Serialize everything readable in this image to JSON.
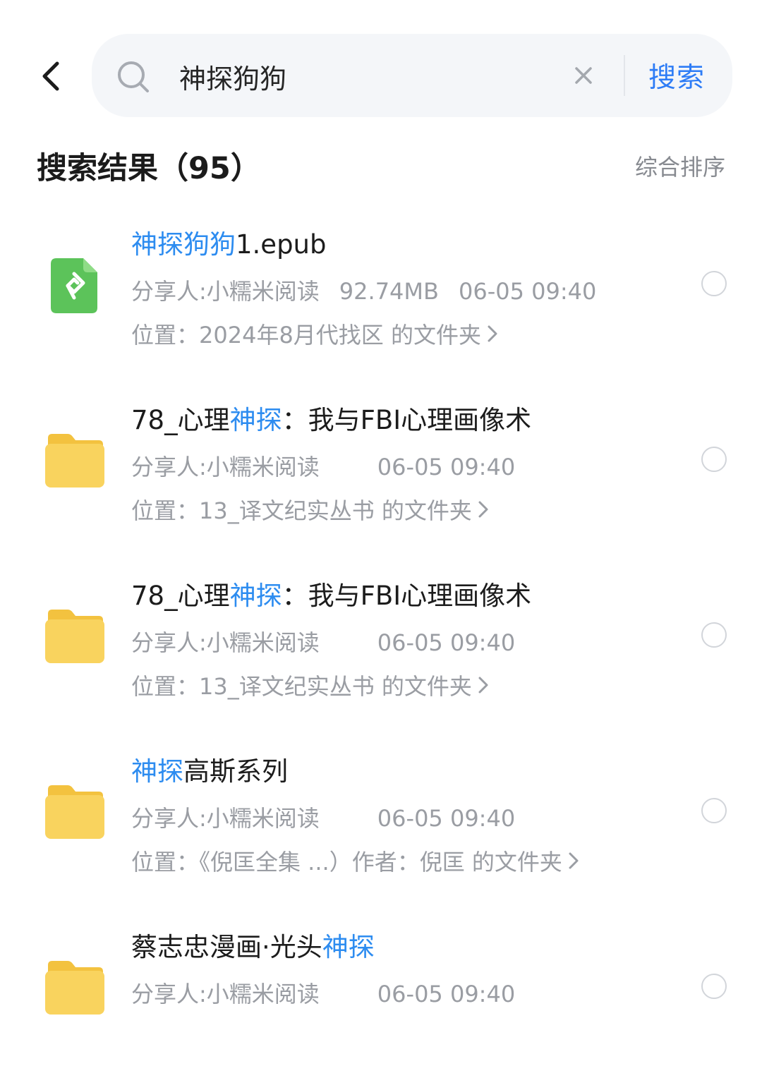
{
  "search": {
    "query": "神探狗狗",
    "search_label": "搜索"
  },
  "results": {
    "title": "搜索结果（95）",
    "sort_label": "综合排序",
    "items": [
      {
        "type": "epub",
        "title_highlight": "神探狗狗",
        "title_rest": "1.epub",
        "sharer": "分享人:小糯米阅读",
        "size": "92.74MB",
        "time": "06-05 09:40",
        "location": "位置：2024年8月代找区 的文件夹"
      },
      {
        "type": "folder",
        "title_prefix": "78_心理",
        "title_highlight": "神探",
        "title_rest": "：我与FBI心理画像术",
        "sharer": "分享人:小糯米阅读",
        "size": "",
        "time": "06-05 09:40",
        "location": "位置：13_译文纪实丛书 的文件夹"
      },
      {
        "type": "folder",
        "title_prefix": "78_心理",
        "title_highlight": "神探",
        "title_rest": "：我与FBI心理画像术",
        "sharer": "分享人:小糯米阅读",
        "size": "",
        "time": "06-05 09:40",
        "location": "位置：13_译文纪实丛书 的文件夹"
      },
      {
        "type": "folder",
        "title_prefix": "",
        "title_highlight": "神探",
        "title_rest": "高斯系列",
        "sharer": "分享人:小糯米阅读",
        "size": "",
        "time": "06-05 09:40",
        "location": "位置：《倪匡全集 ...）作者：倪匡 的文件夹"
      },
      {
        "type": "folder",
        "title_prefix": "蔡志忠漫画·光头",
        "title_highlight": "神探",
        "title_rest": "",
        "sharer": "分享人:小糯米阅读",
        "size": "",
        "time": "06-05 09:40",
        "location": ""
      }
    ]
  },
  "colors": {
    "accent": "#2d8cf0",
    "folder": "#f9d35e",
    "epub": "#5cc35a"
  }
}
